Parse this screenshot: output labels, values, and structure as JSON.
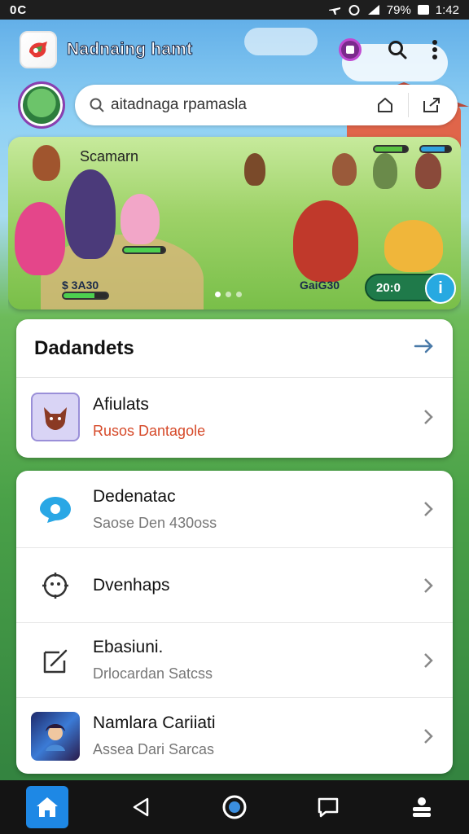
{
  "status_bar": {
    "left_text": "0C",
    "battery": "79%",
    "time": "1:42"
  },
  "app": {
    "title": "Nadnaing hamt",
    "search": {
      "value": "aitadnaga rpamasla"
    },
    "banner": {
      "title": "Scamarn",
      "left_label": "$ 3A30",
      "right_label": "GaiG30",
      "score": "20:0",
      "info_icon": "i"
    },
    "featured_card": {
      "heading": "Dadandets",
      "item": {
        "title": "Afiulats",
        "subtitle": "Rusos Dantagole"
      }
    },
    "list": [
      {
        "icon": "chat-bubble-icon",
        "title": "Dedenatac",
        "subtitle": "Saose Den 430oss"
      },
      {
        "icon": "puzzle-gear-icon",
        "title": "Dvenhaps",
        "subtitle": ""
      },
      {
        "icon": "edit-box-icon",
        "title": "Ebasiuni.",
        "subtitle": "Drlocardan Satcss"
      },
      {
        "icon": "game-thumbnail",
        "title": "Namlara Cariiati",
        "subtitle": "Assea Dari Sarcas"
      }
    ]
  },
  "colors": {
    "accent": "#1e88e5",
    "banner_green": "#79bf49",
    "subtitle_red": "#d64a2a"
  }
}
